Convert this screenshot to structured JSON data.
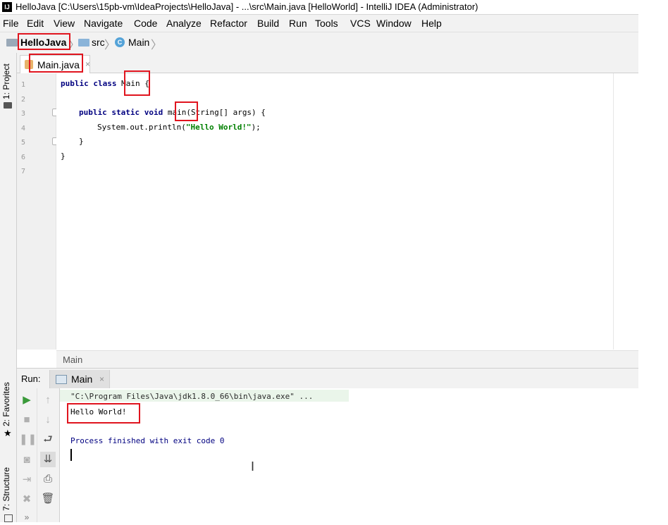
{
  "window": {
    "title": "HelloJava [C:\\Users\\15pb-vm\\IdeaProjects\\HelloJava] - ...\\src\\Main.java [HelloWorld] - IntelliJ IDEA (Administrator)",
    "icon": "intellij-idea-icon"
  },
  "menu": [
    "File",
    "Edit",
    "View",
    "Navigate",
    "Code",
    "Analyze",
    "Refactor",
    "Build",
    "Run",
    "Tools",
    "VCS",
    "Window",
    "Help"
  ],
  "navbar": {
    "project": "HelloJava",
    "folder": "src",
    "file": "Main"
  },
  "left_tool_tabs": {
    "project": "1: Project",
    "favorites": "2: Favorites",
    "structure": "7: Structure"
  },
  "editor_tab": {
    "label": "Main.java",
    "close": "×"
  },
  "line_numbers": [
    "1",
    "2",
    "3",
    "4",
    "5",
    "6",
    "7"
  ],
  "code": {
    "l1_kw": "public class ",
    "l1_name": "Main",
    "l1_rest": " {",
    "l3_kw": "public static void ",
    "l3_name": "main",
    "l3_rest": "(String[] args) {",
    "l4_pre": "System.out.println(",
    "l4_str": "\"Hello World!\"",
    "l4_post": ");",
    "l5": "}",
    "l6": "}"
  },
  "editor_breadcrumb": "Main",
  "run_window": {
    "label": "Run:",
    "tab": "Main",
    "close": "×"
  },
  "console": {
    "command": "\"C:\\Program Files\\Java\\jdk1.8.0_66\\bin\\java.exe\" ...",
    "output": "Hello World!",
    "exit": "Process finished with exit code 0"
  },
  "colors": {
    "keyword": "#000080",
    "string": "#008000",
    "annotation": "#e0141e",
    "current_line": "#fffae3"
  }
}
